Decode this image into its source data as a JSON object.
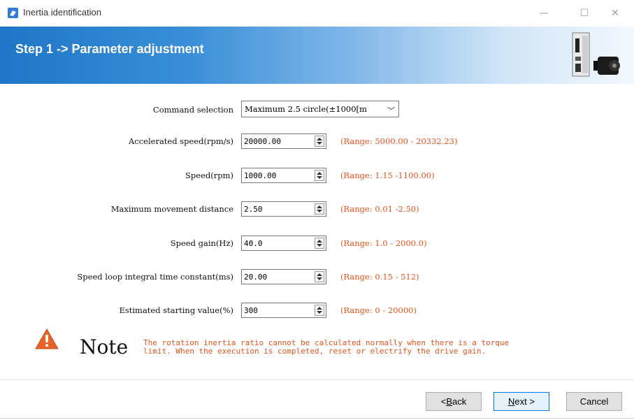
{
  "window": {
    "title": "Inertia identification",
    "controls": {
      "minimize": "—",
      "maximize": "☐",
      "close": "✕"
    }
  },
  "banner": {
    "title": "Step 1 -> Parameter adjustment",
    "colors": {
      "start": "#1f76c7",
      "end": "#f3f8fd"
    }
  },
  "form": {
    "command_selection": {
      "label": "Command selection",
      "value": "Maximum 2.5 circle(±1000[m"
    },
    "fields": [
      {
        "label": "Accelerated speed(rpm/s)",
        "value": "20000.00",
        "range": "(Range: 5000.00 - 20332.23)"
      },
      {
        "label": "Speed(rpm)",
        "value": "1000.00",
        "range": "(Range: 1.15 -1100.00)"
      },
      {
        "label": "Maximum movement distance",
        "value": "2.50",
        "range": "(Range: 0.01 -2.50)"
      },
      {
        "label": "Speed gain(Hz)",
        "value": "40.0",
        "range": "(Range: 1.0 - 2000.0)"
      },
      {
        "label": "Speed loop integral time constant(ms)",
        "value": "20.00",
        "range": "(Range: 0.15 - 512)"
      },
      {
        "label": "Estimated starting value(%)",
        "value": "300",
        "range": "(Range: 0 - 20000)"
      }
    ]
  },
  "note": {
    "icon": "warning-icon",
    "heading": "Note",
    "text": "The rotation inertia ratio cannot be calculated normally when there is a torque limit. When the execution is completed, reset or electrify the drive gain."
  },
  "buttons": {
    "back": {
      "prefix": "< ",
      "accel": "B",
      "rest": "ack"
    },
    "next": {
      "accel": "N",
      "rest": "ext >"
    },
    "cancel": {
      "label": "Cancel"
    }
  },
  "colors": {
    "range_text": "#e8541c",
    "accent": "#0078d7"
  }
}
